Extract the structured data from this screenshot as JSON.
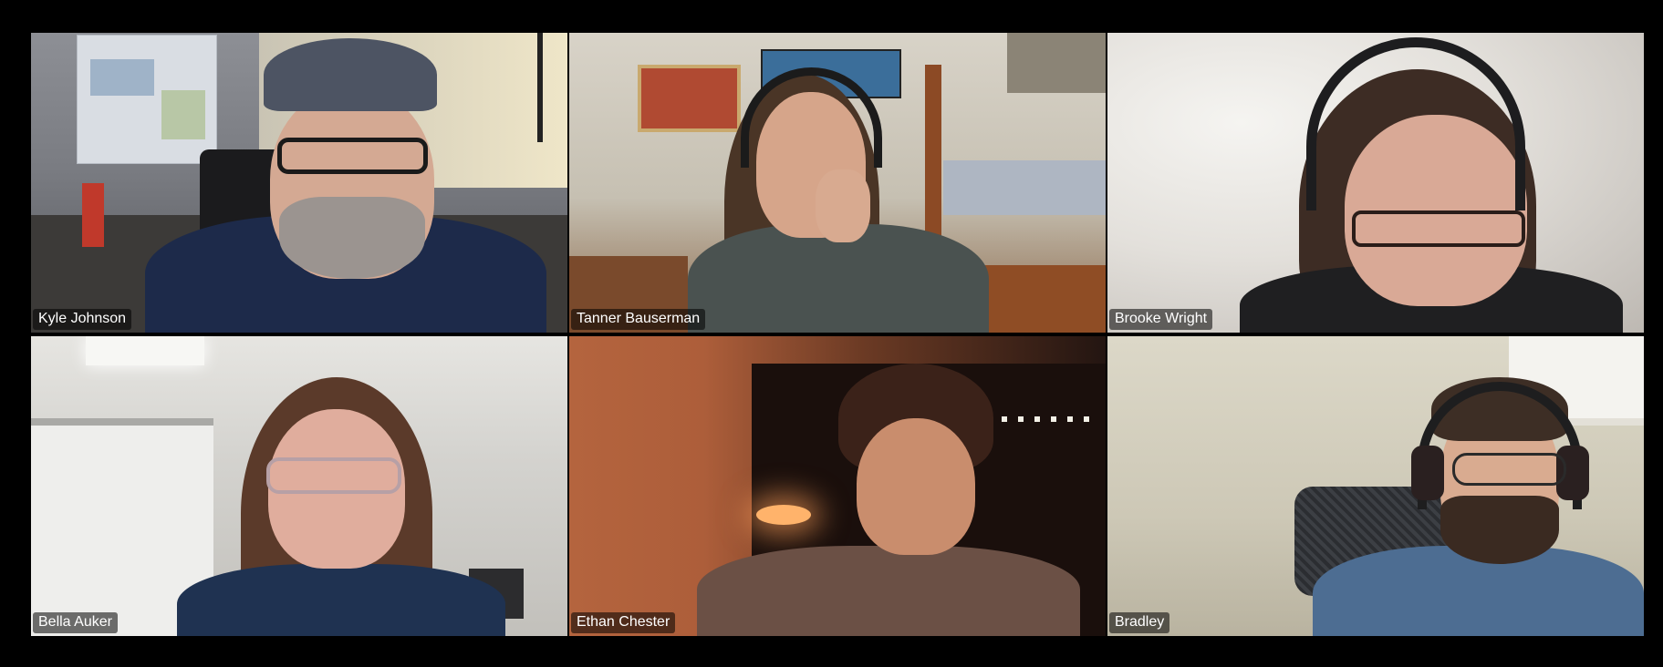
{
  "meeting": {
    "participants": [
      {
        "name": "Kyle Johnson"
      },
      {
        "name": "Tanner Bauserman"
      },
      {
        "name": "Brooke Wright"
      },
      {
        "name": "Bella Auker"
      },
      {
        "name": "Ethan Chester"
      },
      {
        "name": "Bradley"
      }
    ]
  },
  "colors": {
    "background": "#000000",
    "name_tag_bg": "rgba(0,0,0,0.55)",
    "name_tag_text": "#ffffff"
  }
}
